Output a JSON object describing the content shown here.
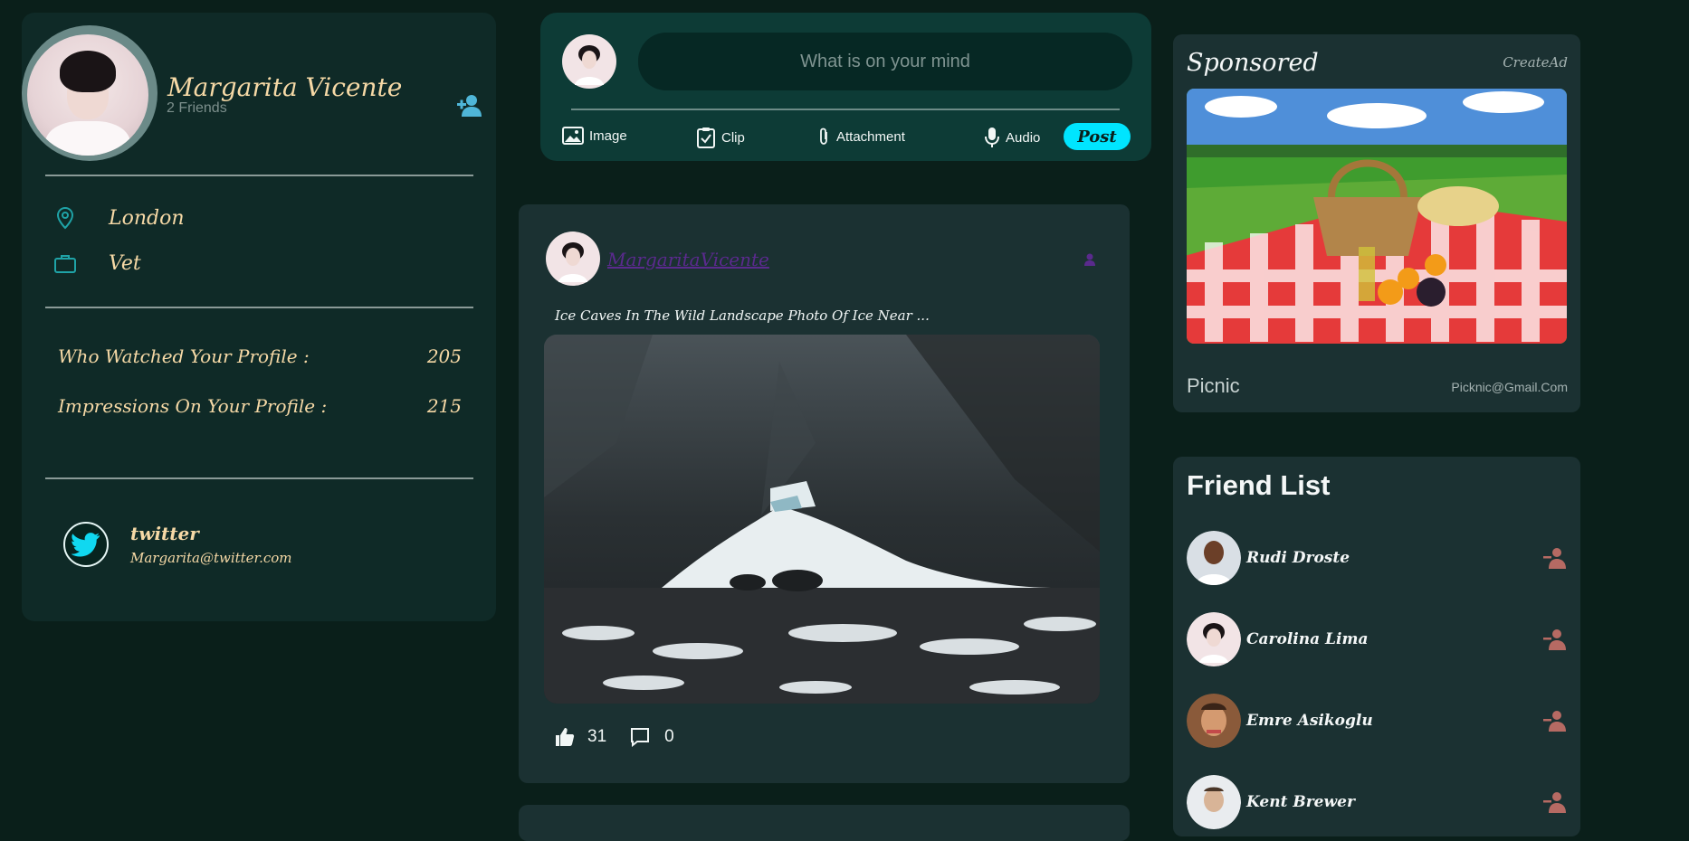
{
  "profile": {
    "name": "Margarita Vicente",
    "friends_count": "2 Friends",
    "location": "London",
    "occupation": "Vet",
    "stats": [
      {
        "label": "Who Watched Your Profile :",
        "value": "205"
      },
      {
        "label": "Impressions On Your Profile :",
        "value": "215"
      }
    ],
    "social": {
      "network": "twitter",
      "handle": "Margarita@twitter.com"
    }
  },
  "composer": {
    "placeholder": "What is on your mind",
    "options": [
      "Image",
      "Clip",
      "Attachment",
      "Audio"
    ],
    "post_label": "Post"
  },
  "post": {
    "author": "MargaritaVicente",
    "description": "Ice Caves In The Wild Landscape Photo Of Ice Near ...",
    "likes": "31",
    "comments": "0"
  },
  "sponsored": {
    "title": "Sponsored",
    "create_label": "CreateAd",
    "name": "Picnic",
    "email": "Picknic@Gmail.Com"
  },
  "friend_list": {
    "title": "Friend List",
    "items": [
      {
        "name": "Rudi Droste"
      },
      {
        "name": "Carolina Lima"
      },
      {
        "name": "Emre Asikoglu"
      },
      {
        "name": "Kent Brewer"
      }
    ]
  },
  "colors": {
    "background": "#0a1f1a",
    "card": "#1b3132",
    "accent_text": "#f6d9a6",
    "post_button": "#00e5ff",
    "icon_accent": "#4fb6d8"
  }
}
